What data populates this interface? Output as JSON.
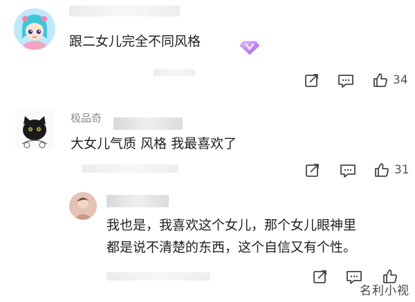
{
  "comments": [
    {
      "username": "",
      "text": "跟二女儿完全不同风格",
      "likes": "34",
      "badge_icon": "purple-gem-badge-icon"
    },
    {
      "username": "极品奇",
      "text": "大女儿气质 风格 我最喜欢了",
      "likes": "31"
    },
    {
      "username": "",
      "lines": [
        "我也是，我喜欢这个女儿，那个女儿眼神里",
        "都是说不清楚的东西，这个自信又有个性。"
      ],
      "likes": ""
    }
  ],
  "watermark": "名利小视",
  "colors": {
    "accent_purple": "#b67cf5",
    "icon_gray": "#444444"
  }
}
